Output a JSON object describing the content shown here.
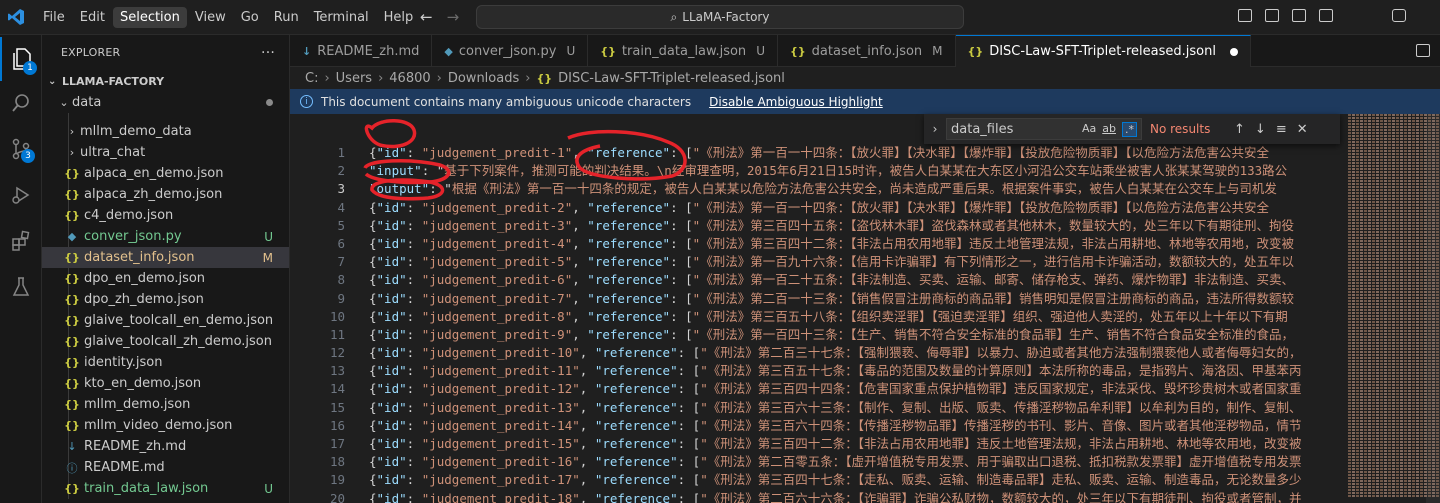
{
  "menu": [
    "File",
    "Edit",
    "Selection",
    "View",
    "Go",
    "Run",
    "Terminal",
    "Help"
  ],
  "command_center": "LLaMA-Factory",
  "activity_bar": {
    "scm_badge": "3"
  },
  "sidebar": {
    "title": "EXPLORER",
    "more": "···",
    "root": "LLAMA-FACTORY",
    "data_folder": "data",
    "items": [
      {
        "label": "mllm_demo_data",
        "type": "folder",
        "status": ""
      },
      {
        "label": "ultra_chat",
        "type": "folder",
        "status": ""
      },
      {
        "label": "alpaca_en_demo.json",
        "type": "json",
        "status": ""
      },
      {
        "label": "alpaca_zh_demo.json",
        "type": "json",
        "status": ""
      },
      {
        "label": "c4_demo.json",
        "type": "json",
        "status": ""
      },
      {
        "label": "conver_json.py",
        "type": "py",
        "status": "U"
      },
      {
        "label": "dataset_info.json",
        "type": "json",
        "status": "M"
      },
      {
        "label": "dpo_en_demo.json",
        "type": "json",
        "status": ""
      },
      {
        "label": "dpo_zh_demo.json",
        "type": "json",
        "status": ""
      },
      {
        "label": "glaive_toolcall_en_demo.json",
        "type": "json",
        "status": ""
      },
      {
        "label": "glaive_toolcall_zh_demo.json",
        "type": "json",
        "status": ""
      },
      {
        "label": "identity.json",
        "type": "json",
        "status": ""
      },
      {
        "label": "kto_en_demo.json",
        "type": "json",
        "status": ""
      },
      {
        "label": "mllm_demo.json",
        "type": "json",
        "status": ""
      },
      {
        "label": "mllm_video_demo.json",
        "type": "json",
        "status": ""
      },
      {
        "label": "README_zh.md",
        "type": "md",
        "status": ""
      },
      {
        "label": "README.md",
        "type": "info",
        "status": ""
      },
      {
        "label": "train_data_law.json",
        "type": "json",
        "status": "U"
      }
    ]
  },
  "tabs": [
    {
      "label": "README_zh.md",
      "icon": "md",
      "status": ""
    },
    {
      "label": "conver_json.py",
      "icon": "py",
      "status": "U"
    },
    {
      "label": "train_data_law.json",
      "icon": "json",
      "status": "U"
    },
    {
      "label": "dataset_info.json",
      "icon": "json",
      "status": "M"
    },
    {
      "label": "DISC-Law-SFT-Triplet-released.jsonl",
      "icon": "json",
      "status": ""
    }
  ],
  "breadcrumb": [
    "C:",
    "Users",
    "46800",
    "Downloads",
    "DISC-Law-SFT-Triplet-released.jsonl"
  ],
  "banner": {
    "message": "This document contains many ambiguous unicode characters",
    "link": "Disable Ambiguous Highlight"
  },
  "find_widget": {
    "query": "data_files",
    "case_option": "Aa",
    "word_option": "ab",
    "regex_option": ".*",
    "result": "No results"
  },
  "editor_lines": [
    {
      "n": "1",
      "id": "judgement_predit-1",
      "ref": "《刑法》第一百一十四条：【放火罪】【决水罪】【爆炸罪】【投放危险物质罪】【以危险方法危害公共安全"
    },
    {
      "n": "2",
      "kind": "input",
      "text": "基于下列案件，推测可能的判决结果。\\n经审理查明，2015年6月21日15时许，被告人白某某在大东区小河沿公交车站乘坐被害人张某某驾驶的133路公"
    },
    {
      "n": "3",
      "kind": "output",
      "text": "根据《刑法》第一百一十四条的规定，被告人白某某以危险方法危害公共安全，尚未造成严重后果。根据案件事实，被告人白某某在公交车上与司机发"
    },
    {
      "n": "4",
      "id": "judgement_predit-2",
      "ref": "《刑法》第一百一十四条：【放火罪】【决水罪】【爆炸罪】【投放危险物质罪】【以危险方法危害公共安全"
    },
    {
      "n": "5",
      "id": "judgement_predit-3",
      "ref": "《刑法》第三百四十五条：【盗伐林木罪】盗伐森林或者其他林木，数量较大的，处三年以下有期徒刑、拘役"
    },
    {
      "n": "6",
      "id": "judgement_predit-4",
      "ref": "《刑法》第三百四十二条：【非法占用农用地罪】违反土地管理法规，非法占用耕地、林地等农用地，改变被"
    },
    {
      "n": "7",
      "id": "judgement_predit-5",
      "ref": "《刑法》第一百九十六条：【信用卡诈骗罪】有下列情形之一，进行信用卡诈骗活动，数额较大的，处五年以"
    },
    {
      "n": "8",
      "id": "judgement_predit-6",
      "ref": "《刑法》第一百二十五条：【非法制造、买卖、运输、邮寄、储存枪支、弹药、爆炸物罪】非法制造、买卖、"
    },
    {
      "n": "9",
      "id": "judgement_predit-7",
      "ref": "《刑法》第二百一十三条：【销售假冒注册商标的商品罪】销售明知是假冒注册商标的商品，违法所得数额较"
    },
    {
      "n": "10",
      "id": "judgement_predit-8",
      "ref": "《刑法》第三百五十八条：【组织卖淫罪】【强迫卖淫罪】组织、强迫他人卖淫的，处五年以上十年以下有期"
    },
    {
      "n": "11",
      "id": "judgement_predit-9",
      "ref": "《刑法》第一百四十三条：【生产、销售不符合安全标准的食品罪】生产、销售不符合食品安全标准的食品，"
    },
    {
      "n": "12",
      "id": "judgement_predit-10",
      "ref": "《刑法》第二百三十七条：【强制猥亵、侮辱罪】以暴力、胁迫或者其他方法强制猥亵他人或者侮辱妇女的，"
    },
    {
      "n": "13",
      "id": "judgement_predit-11",
      "ref": "《刑法》第三百五十七条：【毒品的范围及数量的计算原则】本法所称的毒品，是指鸦片、海洛因、甲基苯丙"
    },
    {
      "n": "14",
      "id": "judgement_predit-12",
      "ref": "《刑法》第三百四十四条：【危害国家重点保护植物罪】违反国家规定，非法采伐、毁坏珍贵树木或者国家重"
    },
    {
      "n": "15",
      "id": "judgement_predit-13",
      "ref": "《刑法》第三百六十三条：【制作、复制、出版、贩卖、传播淫秽物品牟利罪】以牟利为目的，制作、复制、"
    },
    {
      "n": "16",
      "id": "judgement_predit-14",
      "ref": "《刑法》第三百六十四条：【传播淫秽物品罪】传播淫秽的书刊、影片、音像、图片或者其他淫秽物品，情节"
    },
    {
      "n": "17",
      "id": "judgement_predit-15",
      "ref": "《刑法》第三百四十二条：【非法占用农用地罪】违反土地管理法规，非法占用耕地、林地等农用地，改变被"
    },
    {
      "n": "18",
      "id": "judgement_predit-16",
      "ref": "《刑法》第二百零五条：【虚开增值税专用发票、用于骗取出口退税、抵扣税款发票罪】虚开增值税专用发票"
    },
    {
      "n": "19",
      "id": "judgement_predit-17",
      "ref": "《刑法》第三百四十七条：【走私、贩卖、运输、制造毒品罪】走私、贩卖、运输、制造毒品，无论数量多少"
    },
    {
      "n": "20",
      "id": "judgement_predit-18",
      "ref": "《刑法》第二百六十六条：【诈骗罪】诈骗公私财物，数额较大的，处三年以下有期徒刑、拘役或者管制，并"
    }
  ],
  "syntax_keys": {
    "id": "\"id\"",
    "reference": "\"reference\"",
    "input": "\"input\"",
    "output": "\"output\""
  }
}
